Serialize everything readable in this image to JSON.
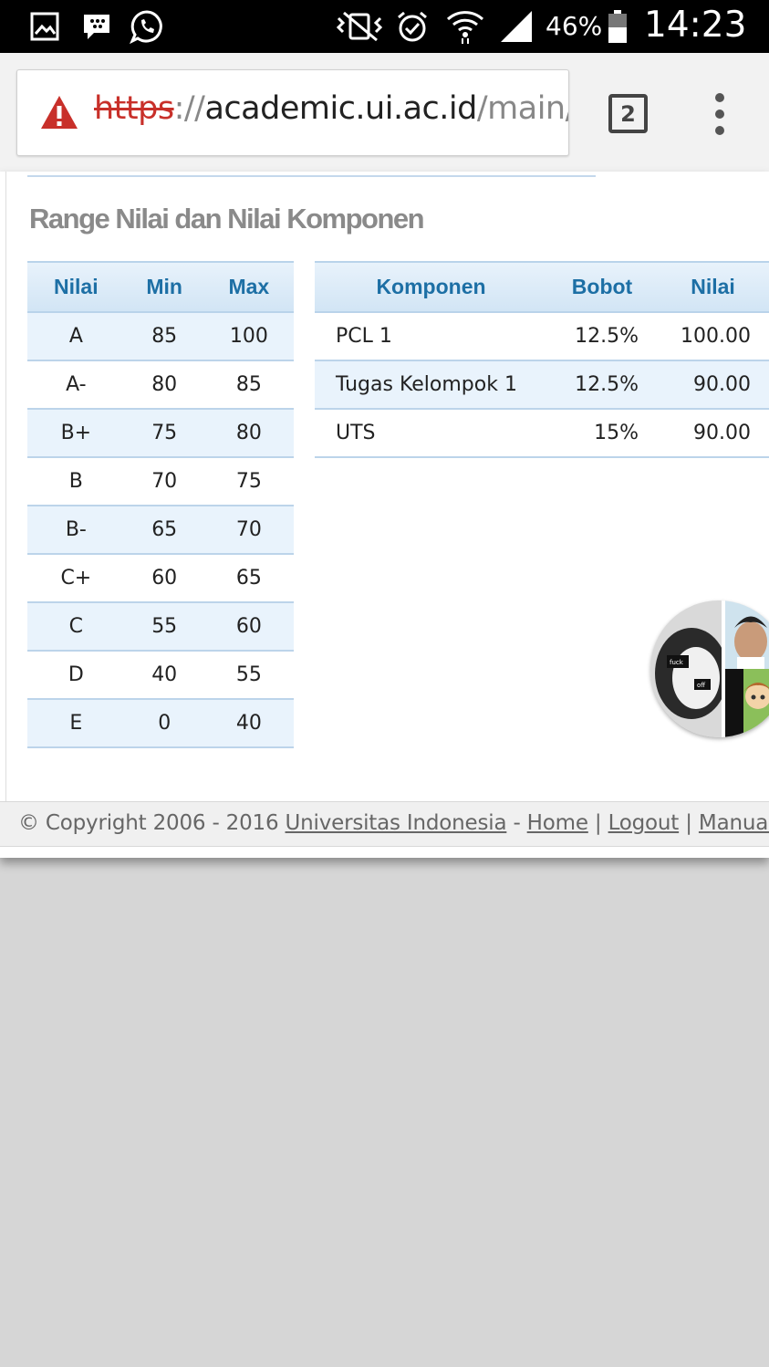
{
  "status_bar": {
    "battery": "46%",
    "time": "14:23",
    "icons": [
      "gallery-icon",
      "bbm-icon",
      "whatsapp-icon",
      "vibrate-icon",
      "alarm-icon",
      "wifi-icon",
      "signal-icon",
      "battery-icon"
    ]
  },
  "browser": {
    "url_scheme": "https",
    "url_sep": "://",
    "url_host": "academic.ui.ac.id",
    "url_path": "/main/",
    "tab_count": "2",
    "warning_color": "#c8302a"
  },
  "section": {
    "title": "Range Nilai dan Nilai Komponen"
  },
  "grade_table": {
    "headers": [
      "Nilai",
      "Min",
      "Max"
    ],
    "rows": [
      [
        "A",
        "85",
        "100"
      ],
      [
        "A-",
        "80",
        "85"
      ],
      [
        "B+",
        "75",
        "80"
      ],
      [
        "B",
        "70",
        "75"
      ],
      [
        "B-",
        "65",
        "70"
      ],
      [
        "C+",
        "60",
        "65"
      ],
      [
        "C",
        "55",
        "60"
      ],
      [
        "D",
        "40",
        "55"
      ],
      [
        "E",
        "0",
        "40"
      ]
    ]
  },
  "component_table": {
    "headers": [
      "Komponen",
      "Bobot",
      "Nilai"
    ],
    "rows": [
      [
        "PCL 1",
        "12.5%",
        "100.00"
      ],
      [
        "Tugas Kelompok 1",
        "12.5%",
        "90.00"
      ],
      [
        "UTS",
        "15%",
        "90.00"
      ]
    ]
  },
  "avatar": {
    "sticker_labels": [
      "fuck",
      "off"
    ]
  },
  "footer": {
    "copyright": "© Copyright 2006 - 2016 ",
    "university_link": "Universitas Indonesia",
    "dash": " - ",
    "home_link": "Home",
    "sep": " | ",
    "logout_link": "Logout",
    "manual_link": "Manual",
    "trailing_sep": " |"
  }
}
